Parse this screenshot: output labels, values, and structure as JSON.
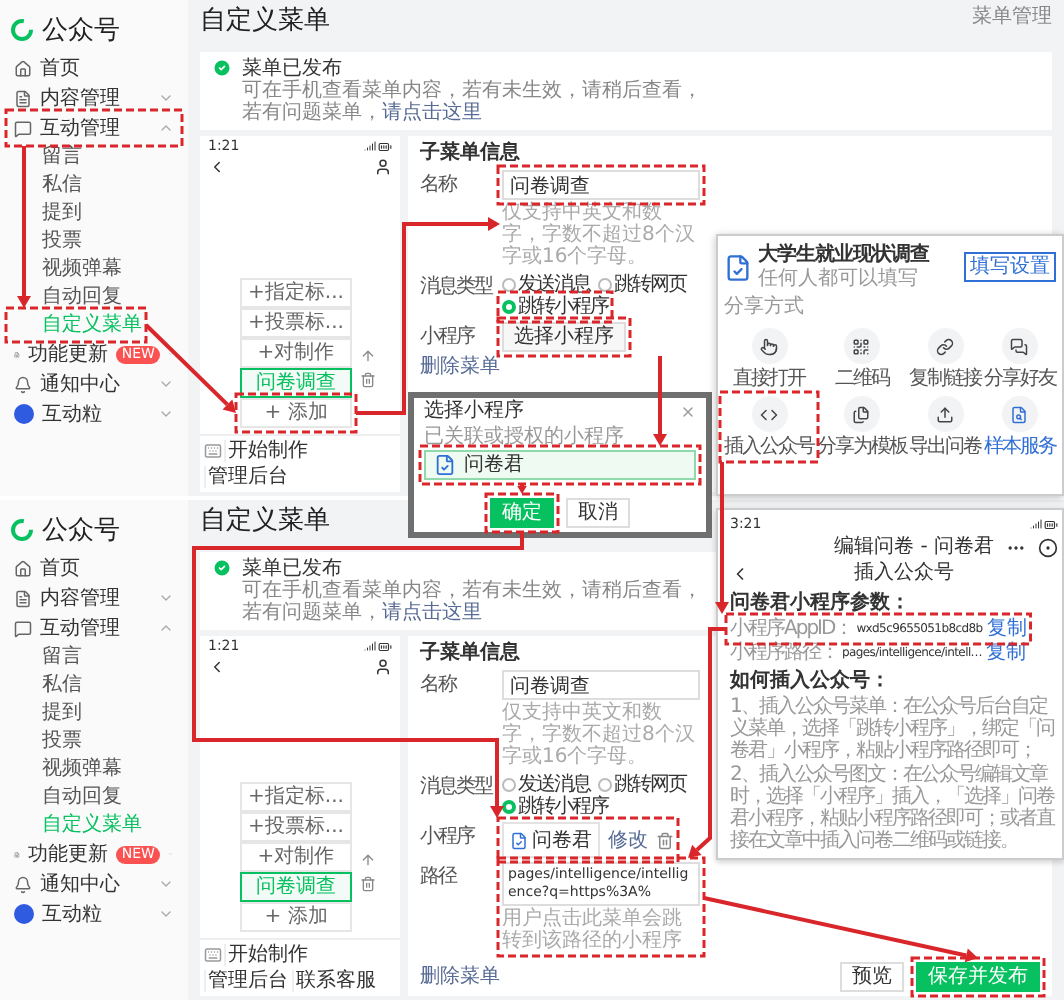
{
  "panels": [
    {
      "sidebar": {
        "brand": "公众号",
        "items": [
          {
            "label": "首页"
          },
          {
            "label": "内容管理",
            "expanded": false
          },
          {
            "label": "互动管理",
            "expanded": true,
            "children": [
              {
                "label": "留言",
                "selected": false
              },
              {
                "label": "私信",
                "selected": false
              },
              {
                "label": "提到",
                "selected": false
              },
              {
                "label": "投票",
                "selected": false
              },
              {
                "label": "视频弹幕",
                "selected": false
              },
              {
                "label": "自动回复",
                "selected": false
              },
              {
                "label": "自定义菜单",
                "selected": true
              }
            ]
          },
          {
            "label": "功能更新",
            "badge": "NEW",
            "expanded": false
          },
          {
            "label": "通知中心",
            "expanded": false
          },
          {
            "label": "互动粒",
            "expanded": false
          }
        ]
      },
      "page_title": "自定义菜单",
      "header_link": "菜单管理",
      "notice": {
        "title": "菜单已发布",
        "text": "可在手机查看菜单内容，若有未生效，请稍后查看，若有问题菜单，",
        "link": "请点击这里"
      },
      "phone": {
        "time": "1:21",
        "submenu": [
          {
            "label": "+指定标...",
            "selected": false
          },
          {
            "label": "+投票标...",
            "selected": false
          },
          {
            "label": "+对制作",
            "selected": false
          },
          {
            "label": "问卷调查",
            "selected": true
          }
        ],
        "add": "+ 添加",
        "menu_bar": [
          "开始制作",
          "管理后台"
        ]
      },
      "form": {
        "title": "子菜单信息",
        "fields": [
          {
            "kind": "text",
            "label": "名称",
            "value": "问卷调查",
            "hint": "仅支持中英文和数字，字数不超过8个汉字或16个字母。"
          },
          {
            "kind": "radio",
            "label": "消息类型",
            "options": [
              {
                "label": "发送消息",
                "selected": false
              },
              {
                "label": "跳转网页",
                "selected": false
              },
              {
                "label": "跳转小程序",
                "selected": true
              }
            ]
          },
          {
            "kind": "picker",
            "label": "小程序",
            "button": "选择小程序"
          }
        ],
        "delete": "删除菜单"
      }
    },
    {
      "sidebar": {
        "brand": "公众号",
        "items": [
          {
            "label": "首页"
          },
          {
            "label": "内容管理",
            "expanded": false
          },
          {
            "label": "互动管理",
            "expanded": true,
            "children": [
              {
                "label": "留言",
                "selected": false
              },
              {
                "label": "私信",
                "selected": false
              },
              {
                "label": "提到",
                "selected": false
              },
              {
                "label": "投票",
                "selected": false
              },
              {
                "label": "视频弹幕",
                "selected": false
              },
              {
                "label": "自动回复",
                "selected": false
              },
              {
                "label": "自定义菜单",
                "selected": true
              }
            ]
          },
          {
            "label": "功能更新",
            "badge": "NEW",
            "expanded": false
          },
          {
            "label": "通知中心",
            "expanded": false
          },
          {
            "label": "互动粒",
            "expanded": false
          }
        ]
      },
      "page_title": "自定义菜单",
      "notice": {
        "title": "菜单已发布",
        "text": "可在手机查看菜单内容，若有未生效，请稍后查看，若有问题菜单，",
        "link": "请点击这里"
      },
      "phone": {
        "time": "1:21",
        "submenu": [
          {
            "label": "+指定标...",
            "selected": false
          },
          {
            "label": "+投票标...",
            "selected": false
          },
          {
            "label": "+对制作",
            "selected": false
          },
          {
            "label": "问卷调查",
            "selected": true
          }
        ],
        "add": "+ 添加",
        "menu_bar": [
          "开始制作",
          "管理后台",
          "联系客服"
        ]
      },
      "form": {
        "title": "子菜单信息",
        "fields": [
          {
            "kind": "text",
            "label": "名称",
            "value": "问卷调查",
            "hint": "仅支持中英文和数字，字数不超过8个汉字或16个字母。"
          },
          {
            "kind": "radio",
            "label": "消息类型",
            "options": [
              {
                "label": "发送消息",
                "selected": false
              },
              {
                "label": "跳转网页",
                "selected": false
              },
              {
                "label": "跳转小程序",
                "selected": true
              }
            ]
          },
          {
            "kind": "chip",
            "label": "小程序",
            "name": "问卷君",
            "action": "修改"
          },
          {
            "kind": "path",
            "label": "路径",
            "value": "pages/intelligence/intelligence?q=https%3A%",
            "hint": "用户点击此菜单会跳转到该路径的小程序"
          }
        ],
        "delete": "删除菜单",
        "buttons": [
          {
            "label": "预览",
            "primary": false
          },
          {
            "label": "保存并发布",
            "primary": true
          }
        ]
      }
    }
  ],
  "dialog": {
    "title": "选择小程序",
    "subtitle": "已关联或授权的小程序",
    "items": [
      {
        "name": "问卷君",
        "selected": true
      }
    ],
    "buttons": [
      {
        "label": "确定",
        "primary": true
      },
      {
        "label": "取消",
        "primary": false
      }
    ]
  },
  "share_popup": {
    "title": "大学生就业现状调查",
    "subtitle": "任何人都可以填写",
    "button": "填写设置",
    "section": "分享方式",
    "actions": [
      {
        "label": "直接打开",
        "accent": false
      },
      {
        "label": "二维码",
        "accent": false
      },
      {
        "label": "复制链接",
        "accent": false
      },
      {
        "label": "分享好友",
        "accent": false
      },
      {
        "label": "插入公众号",
        "accent": false
      },
      {
        "label": "分享为模板",
        "accent": false
      },
      {
        "label": "导出问卷",
        "accent": false
      },
      {
        "label": "样本服务",
        "accent": true
      }
    ]
  },
  "phone_popup": {
    "time": "3:21",
    "title": "编辑问卷 - 问卷君",
    "nav_title": "插入公众号",
    "params_title": "问卷君小程序参数：",
    "params": [
      {
        "label": "小程序AppID：",
        "value": "wxd5c9655051b8cd8b",
        "action": "复制"
      },
      {
        "label": "小程序路径：",
        "value": "pages/intelligence/intell…",
        "action": "复制"
      }
    ],
    "howto_title": "如何插入公众号：",
    "howto": [
      "1、插入公众号菜单：在公众号后台自定义菜单，选择「跳转小程序」，绑定「问卷君」小程序，粘贴小程序路径即可；",
      "2、插入公众号图文：在公众号编辑文章时，选择「小程序」插入，「选择」问卷君小程序，粘贴小程序路径即可；或者直接在文章中插入问卷二维码或链接。"
    ]
  }
}
